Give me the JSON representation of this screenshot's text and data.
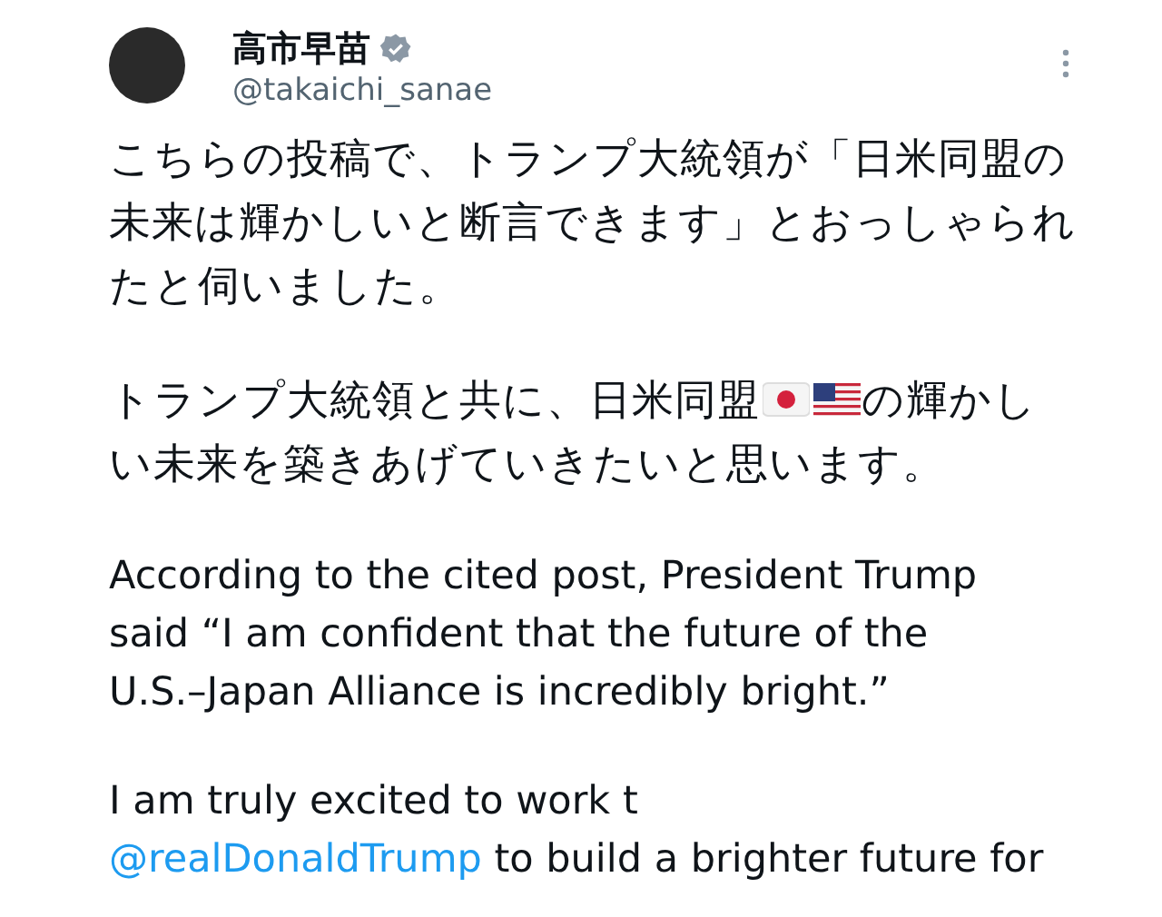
{
  "author": {
    "name": "高市早苗",
    "handle": "@takaichi_sanae",
    "verified": true
  },
  "paragraphs": [
    {
      "kind": "japanese",
      "lines": [
        [
          {
            "kind": "text",
            "text": "こちらの投稿で、トランプ大統領が「日米同盟の"
          }
        ],
        [
          {
            "kind": "text",
            "text": "未来は輝かしいと断言できます」とおっしゃられ"
          }
        ],
        [
          {
            "kind": "text",
            "text": "たと伺いました。"
          }
        ]
      ]
    },
    {
      "kind": "japanese",
      "lines": [
        [
          {
            "kind": "text",
            "text": "トランプ大統領と共に、日米同盟"
          },
          {
            "kind": "flag_japan"
          },
          {
            "kind": "flag_usa"
          },
          {
            "kind": "text",
            "text": "の輝かし"
          }
        ],
        [
          {
            "kind": "text",
            "text": "い未来を築きあげていきたいと思います。"
          }
        ]
      ]
    },
    {
      "kind": "english",
      "lines": [
        [
          {
            "kind": "text",
            "text": "According to the cited post, President Trump"
          }
        ],
        [
          {
            "kind": "text",
            "text": "said “I am confident that the future of the"
          }
        ],
        [
          {
            "kind": "text",
            "text": "U.S.–Japan Alliance is incredibly bright.”"
          }
        ]
      ]
    },
    {
      "kind": "english",
      "lines": [
        [
          {
            "kind": "text",
            "text": "I am truly excited to work t"
          }
        ],
        [
          {
            "kind": "link",
            "text": "@realDonaldTrump"
          },
          {
            "kind": "text",
            "text": " to build a brighter future for"
          }
        ]
      ]
    }
  ]
}
